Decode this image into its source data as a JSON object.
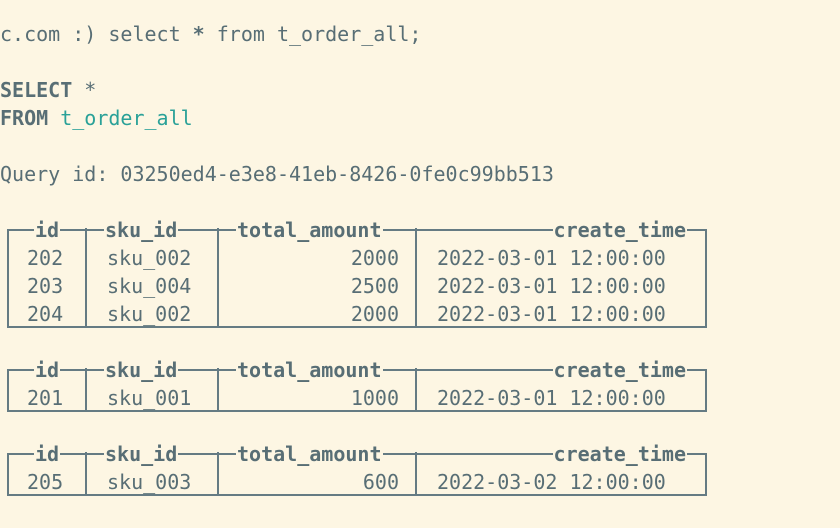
{
  "prompt_line": {
    "host": "c.com :)",
    "command_pre": "select",
    "star": "*",
    "command_post": "from t_order_all;"
  },
  "formatted_query": {
    "select_kw": "SELECT",
    "select_star": "*",
    "from_kw": "FROM",
    "table_name": "t_order_all"
  },
  "query_id": {
    "label": "Query id:",
    "value": "03250ed4-e3e8-41eb-8426-0fe0c99bb513"
  },
  "columns": [
    "id",
    "sku_id",
    "total_amount",
    "create_time"
  ],
  "result_blocks": [
    {
      "rows": [
        [
          "202",
          "sku_002",
          "2000",
          "2022-03-01 12:00:00"
        ],
        [
          "203",
          "sku_004",
          "2500",
          "2022-03-01 12:00:00"
        ],
        [
          "204",
          "sku_002",
          "2000",
          "2022-03-01 12:00:00"
        ]
      ]
    },
    {
      "rows": [
        [
          "201",
          "sku_001",
          "1000",
          "2022-03-01 12:00:00"
        ]
      ]
    },
    {
      "rows": [
        [
          "205",
          "sku_003",
          "600",
          "2022-03-02 12:00:00"
        ]
      ]
    }
  ],
  "colors": {
    "background": "#fdf6e3",
    "text": "#586e75",
    "identifier": "#2aa198",
    "border": "#657b83"
  }
}
